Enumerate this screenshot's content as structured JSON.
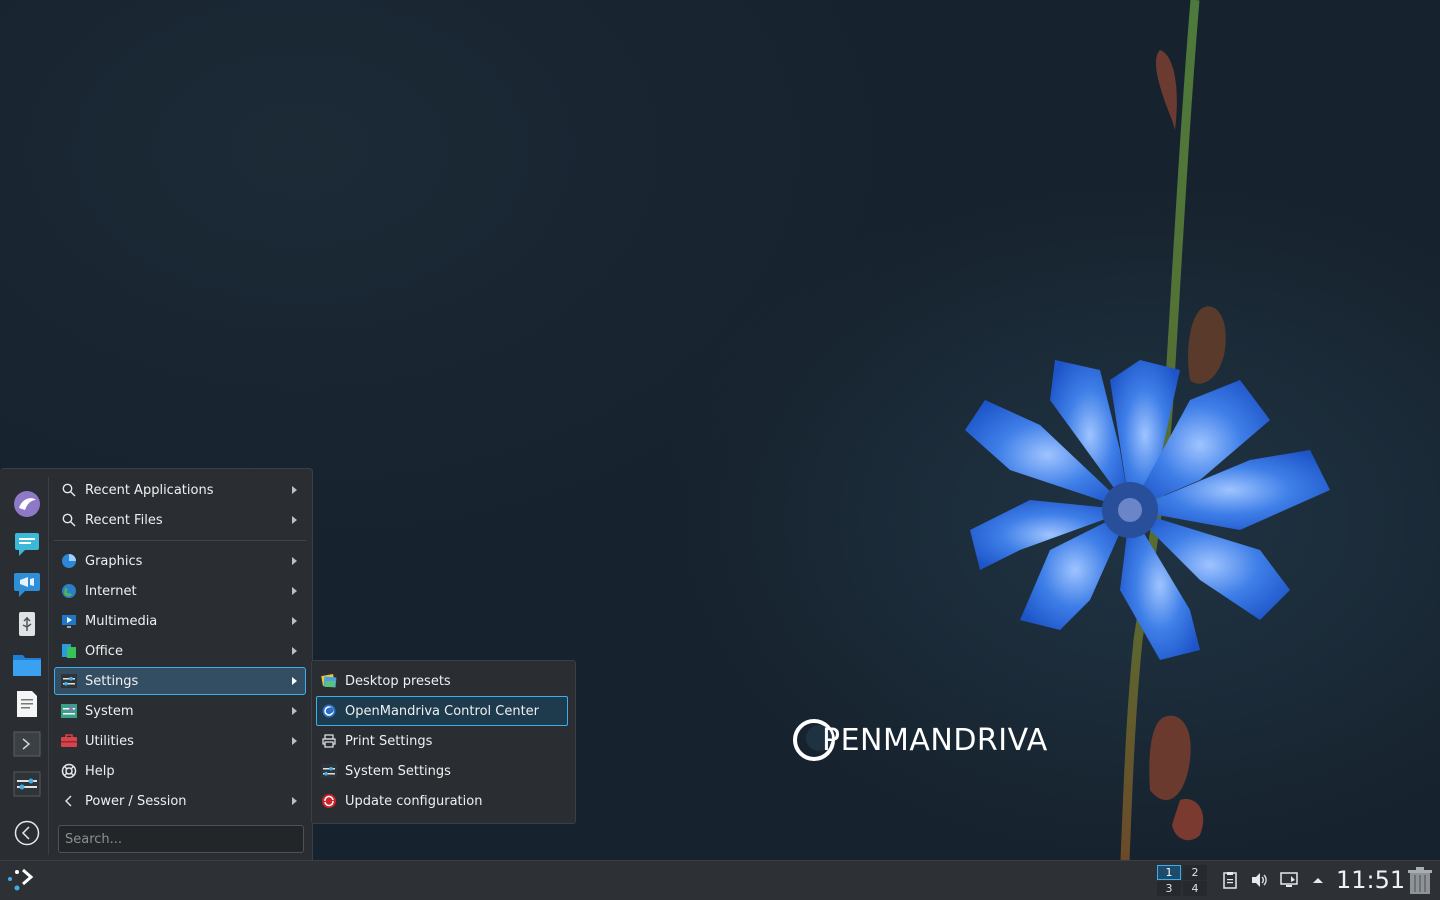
{
  "menu": {
    "items": [
      {
        "label": "Recent Applications",
        "icon": "search-icon",
        "has_submenu": true
      },
      {
        "label": "Recent Files",
        "icon": "search-icon",
        "has_submenu": true
      },
      {
        "label": "Graphics",
        "icon": "graphics-icon",
        "has_submenu": true
      },
      {
        "label": "Internet",
        "icon": "globe-icon",
        "has_submenu": true
      },
      {
        "label": "Multimedia",
        "icon": "multimedia-icon",
        "has_submenu": true
      },
      {
        "label": "Office",
        "icon": "office-icon",
        "has_submenu": true
      },
      {
        "label": "Settings",
        "icon": "settings-icon",
        "has_submenu": true,
        "selected": true
      },
      {
        "label": "System",
        "icon": "system-icon",
        "has_submenu": true
      },
      {
        "label": "Utilities",
        "icon": "utilities-icon",
        "has_submenu": true
      },
      {
        "label": "Help",
        "icon": "help-icon",
        "has_submenu": false
      },
      {
        "label": "Power / Session",
        "icon": "chevron-left-icon",
        "has_submenu": true
      }
    ],
    "search_placeholder": "Search...",
    "favorites": [
      "falkon-browser-icon",
      "chat-icon",
      "konversation-icon",
      "usb-icon",
      "file-manager-icon",
      "text-editor-icon",
      "terminal-icon",
      "system-settings-icon"
    ]
  },
  "submenu": {
    "items": [
      {
        "label": "Desktop presets",
        "icon": "desktop-presets-icon"
      },
      {
        "label": "OpenMandriva Control Center",
        "icon": "openmandriva-icon",
        "selected": true
      },
      {
        "label": "Print Settings",
        "icon": "printer-icon"
      },
      {
        "label": "System Settings",
        "icon": "system-settings-icon"
      },
      {
        "label": "Update configuration",
        "icon": "update-icon"
      }
    ]
  },
  "wallpaper": {
    "logo_text": "PENMANDRIVA",
    "logo_initial": "O"
  },
  "panel": {
    "pager": [
      "1",
      "2",
      "3",
      "4"
    ],
    "active_desktop": "1",
    "clock": "11:51"
  },
  "colors": {
    "accent": "#3daee9",
    "panel_bg": "#2d3135",
    "menu_bg": "#2a2e32"
  }
}
